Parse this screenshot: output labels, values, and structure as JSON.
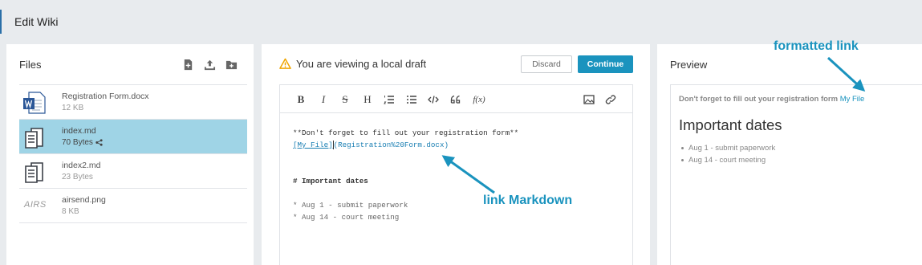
{
  "header": {
    "title": "Edit Wiki"
  },
  "files": {
    "title": "Files",
    "actions": [
      "new-file-icon",
      "upload-icon",
      "new-folder-icon"
    ],
    "items": [
      {
        "name": "Registration Form.docx",
        "meta": "12 KB",
        "icon": "word-doc-icon",
        "selected": false,
        "shared": false
      },
      {
        "name": "index.md",
        "meta": "70 Bytes",
        "icon": "text-file-icon",
        "selected": true,
        "shared": true
      },
      {
        "name": "index2.md",
        "meta": "23 Bytes",
        "icon": "text-file-icon",
        "selected": false,
        "shared": false
      },
      {
        "name": "airsend.png",
        "meta": "8 KB",
        "icon": "image-thumbnail",
        "thumb_text": "AIRS",
        "selected": false,
        "shared": false
      }
    ]
  },
  "editor": {
    "warning": "You are viewing a local draft",
    "discard_label": "Discard",
    "continue_label": "Continue",
    "toolbar": [
      "bold-icon",
      "italic-icon",
      "strikethrough-icon",
      "heading-icon",
      "ordered-list-icon",
      "bullet-list-icon",
      "code-icon",
      "quote-icon",
      "formula-icon",
      "image-icon",
      "link-icon"
    ],
    "lines": {
      "l1": "**Don't forget to fill out your registration form**",
      "l2_link": "[My File]",
      "l2_url": "(Registration%20Form.docx)",
      "l3": "# Important dates",
      "l4": "* Aug 1 - submit paperwork",
      "l5": "* Aug 14 - court meeting"
    }
  },
  "preview": {
    "title": "Preview",
    "text": "Don't forget to fill out your registration form",
    "link": "My File",
    "heading": "Important dates",
    "items": [
      "Aug 1 - submit paperwork",
      "Aug 14 - court meeting"
    ]
  },
  "annotations": {
    "formatted_link": "formatted link",
    "link_markdown": "link Markdown"
  },
  "colors": {
    "accent": "#1a93be",
    "selected_row": "#9fd4e6",
    "warning": "#f0a500"
  }
}
